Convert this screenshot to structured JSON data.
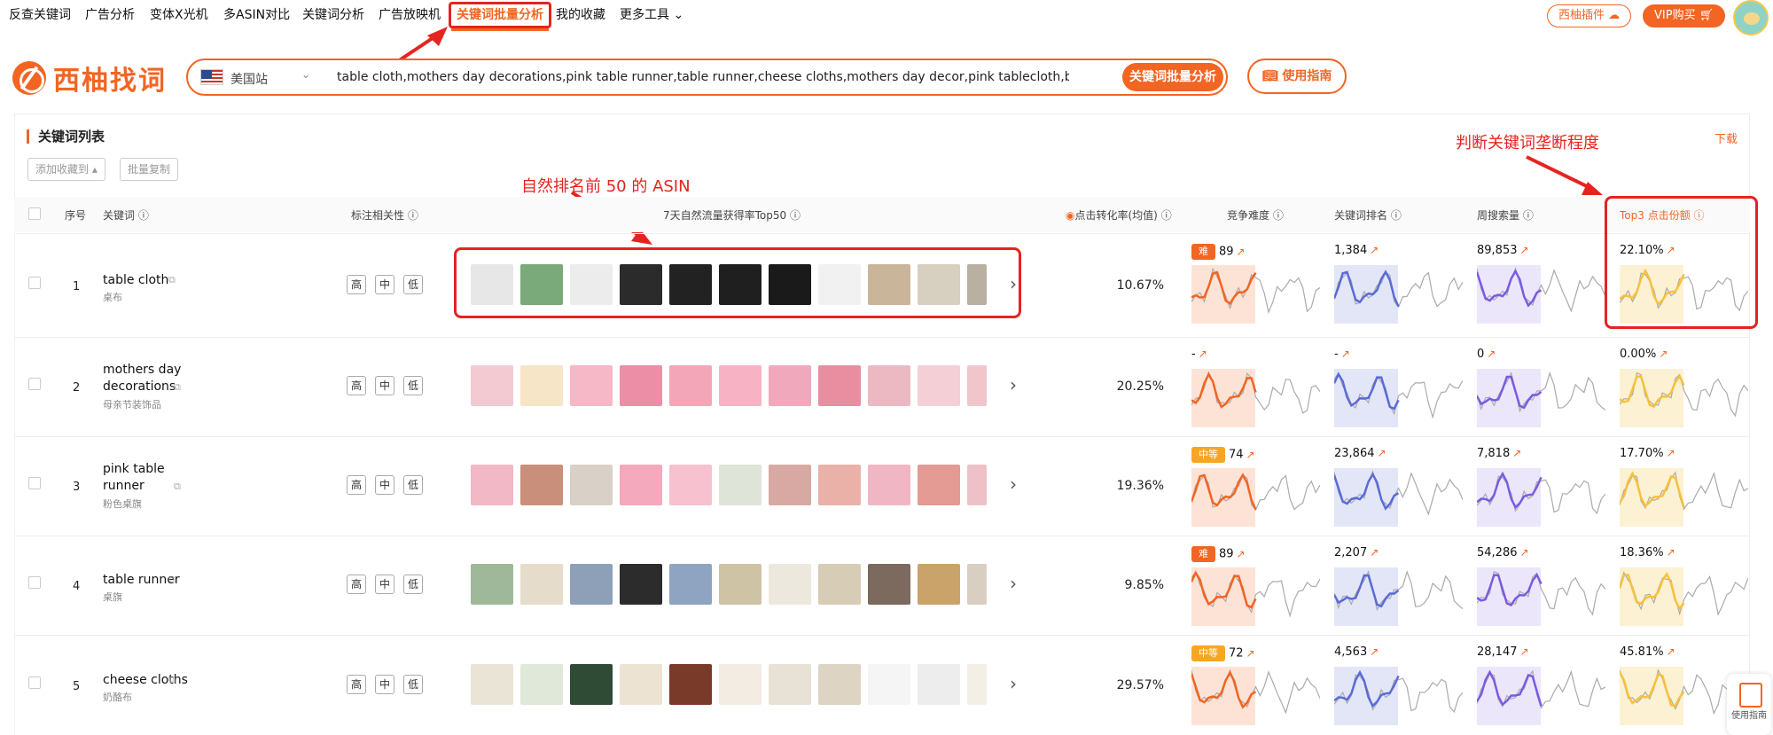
{
  "topnav": {
    "items": [
      "反查关键词",
      "广告分析",
      "变体X光机",
      "多ASIN对比",
      "关键词分析",
      "广告放映机",
      "关键词批量分析",
      "我的收藏",
      "更多工具"
    ],
    "active": "关键词批量分析",
    "plugin_label": "西柚插件",
    "vip_label": "VIP购买"
  },
  "brand": {
    "name": "西柚找词"
  },
  "search": {
    "site": "美国站",
    "query": "table cloth,mothers day decorations,pink table runner,table runner,cheese cloths,mothers day decor,pink tablecloth,baby in bloom baby show",
    "button": "关键词批量分析",
    "guide": "使用指南"
  },
  "section": {
    "title": "关键词列表",
    "download": "下载",
    "add_fav": "添加收藏到",
    "batch_copy": "批量复制"
  },
  "annotations": {
    "asin": "自然排名前 50 的 ASIN",
    "monopoly": "判断关键词垄断程度"
  },
  "columns": {
    "index": "序号",
    "keyword": "关键词",
    "relevance": "标注相关性",
    "top50": "7天自然流量获得率Top50",
    "cvr": "点击转化率(均值)",
    "difficulty": "竞争难度",
    "rank": "关键词排名",
    "volume": "周搜索量",
    "top3": "Top3 点击份额"
  },
  "relevance_labels": [
    "高",
    "中",
    "低"
  ],
  "rows": [
    {
      "index": "1",
      "keyword": "table cloth",
      "keyword_cn": "桌布",
      "cvr": "10.67%",
      "difficulty_badge": "难",
      "difficulty": "89",
      "rank": "1,384",
      "volume": "89,853",
      "top3": "22.10%"
    },
    {
      "index": "2",
      "keyword": "mothers day decorations",
      "keyword_cn": "母亲节装饰品",
      "cvr": "20.25%",
      "difficulty_badge": "",
      "difficulty": "-",
      "rank": "-",
      "volume": "0",
      "top3": "0.00%"
    },
    {
      "index": "3",
      "keyword": "pink table runner",
      "keyword_cn": "粉色桌旗",
      "cvr": "19.36%",
      "difficulty_badge": "中等",
      "difficulty": "74",
      "rank": "23,864",
      "volume": "7,818",
      "top3": "17.70%"
    },
    {
      "index": "4",
      "keyword": "table runner",
      "keyword_cn": "桌旗",
      "cvr": "9.85%",
      "difficulty_badge": "难",
      "difficulty": "89",
      "rank": "2,207",
      "volume": "54,286",
      "top3": "18.36%"
    },
    {
      "index": "5",
      "keyword": "cheese cloths",
      "keyword_cn": "奶酪布",
      "cvr": "29.57%",
      "difficulty_badge": "中等",
      "difficulty": "72",
      "rank": "4,563",
      "volume": "28,147",
      "top3": "45.81%"
    }
  ],
  "float_help": "使用指南",
  "colors": {
    "accent": "#f26522",
    "annotation": "#e5231f",
    "rank_line": "#5b6bd6",
    "volume_line": "#7b5be0",
    "top3_line": "#f6c13d"
  }
}
